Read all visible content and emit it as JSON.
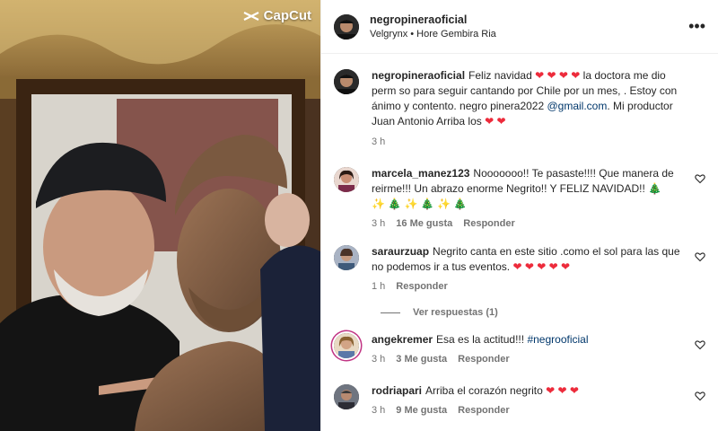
{
  "media": {
    "watermark": "CapCut"
  },
  "header": {
    "username": "negropineraoficial",
    "subtitle": "Velgrynx • Hore Gembira Ria",
    "more_icon": "more-horizontal-icon"
  },
  "caption": {
    "username": "negropineraoficial",
    "text_1": "Feliz navidad",
    "hearts_1": "❤ ❤ ❤ ❤",
    "text_2": "la doctora me dio perm so para seguir cantando por Chile por un mes,",
    "text_3": ". Estoy con ánimo y contento. negro pinera2022",
    "email": "@gmail.com",
    "text_4": ". Mi productor Juan Antonio Arriba los",
    "hearts_2": "❤ ❤",
    "time": "3 h"
  },
  "comments": [
    {
      "username": "marcela_manez123",
      "text": "Nooooooo!! Te pasaste!!!! Que manera de reirme!!! Un abrazo enorme Negrito!! Y FELIZ NAVIDAD!! 🎄",
      "emojis": "✨ 🎄 ✨ 🎄 ✨ 🎄",
      "time": "3 h",
      "likes": "16 Me gusta",
      "reply": "Responder"
    },
    {
      "username": "saraurzuap",
      "text": "Negrito canta en este sitio .como el sol para las que no podemos ir a tus eventos.",
      "hearts": "❤ ❤ ❤ ❤ ❤",
      "time": "1 h",
      "reply": "Responder",
      "view_replies": "Ver respuestas (1)"
    },
    {
      "username": "angekremer",
      "text": "Esa es la actitud!!!",
      "hashtag": "#negrooficial",
      "time": "3 h",
      "likes": "3 Me gusta",
      "reply": "Responder"
    },
    {
      "username": "rodriapari",
      "text": "Arriba el corazón negrito",
      "hearts": "❤ ❤ ❤",
      "time": "3 h",
      "likes": "9 Me gusta",
      "reply": "Responder"
    }
  ],
  "colors": {
    "link": "#00376b",
    "heart": "#ed2b3b",
    "muted": "#737373"
  }
}
